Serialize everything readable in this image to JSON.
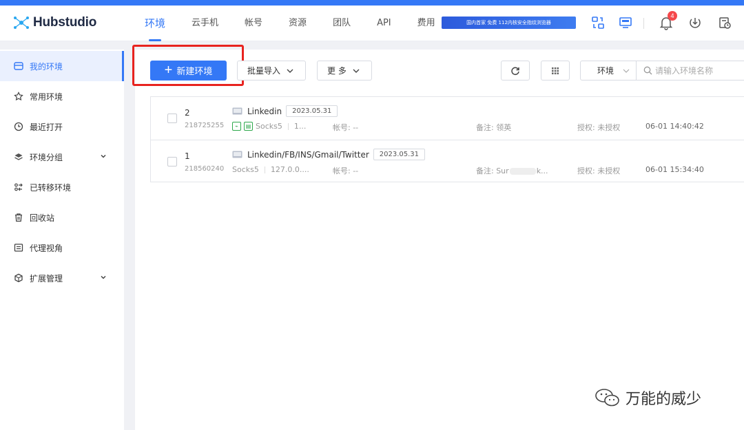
{
  "app": {
    "name": "Hubstudio"
  },
  "header": {
    "nav": [
      "环境",
      "云手机",
      "帐号",
      "资源",
      "团队",
      "API",
      "费用"
    ],
    "promo": "国内首家 免费 112内核安全指纹浏览器",
    "notification_count": "4",
    "icons": [
      "switch-env-icon",
      "monitor-icon",
      "bell-icon",
      "download-icon",
      "schedule-icon"
    ]
  },
  "sidebar": {
    "items": [
      {
        "label": "我的环境",
        "icon": "browser-window-icon",
        "active": true
      },
      {
        "label": "常用环境",
        "icon": "star-icon"
      },
      {
        "label": "最近打开",
        "icon": "clock-icon"
      },
      {
        "label": "环境分组",
        "icon": "layers-icon",
        "expandable": true
      },
      {
        "label": "已转移环境",
        "icon": "transfer-icon"
      },
      {
        "label": "回收站",
        "icon": "trash-icon"
      },
      {
        "label": "代理视角",
        "icon": "proxy-icon"
      },
      {
        "label": "扩展管理",
        "icon": "extension-icon",
        "expandable": true
      }
    ]
  },
  "toolbar": {
    "new_env": "新建环境",
    "batch_import": "批量导入",
    "more": "更 多",
    "search_scope": "环境",
    "search_placeholder": "请输入环境名称"
  },
  "environments": [
    {
      "seq": "2",
      "id": "218725255",
      "name": "Linkedin",
      "date": "2023.05.31",
      "proxy_type": "Socks5",
      "proxy_host": "1...",
      "account": "帐号: --",
      "remark_prefix": "备注: ",
      "remark": "领英",
      "auth": "授权: 未授权",
      "time": "06-01 14:40:42"
    },
    {
      "seq": "1",
      "id": "218560240",
      "name": "Linkedin/FB/INS/Gmail/Twitter",
      "date": "2023.05.31",
      "proxy_type": "Socks5",
      "proxy_host": "127.0.0....",
      "account": "帐号: --",
      "remark_prefix": "备注: ",
      "remark_start": "Sur",
      "remark_end": "k...",
      "auth": "授权: 未授权",
      "time": "06-01 15:34:40"
    }
  ],
  "watermark": "万能的威少",
  "colors": {
    "accent": "#3478f6",
    "highlight": "#e8231f",
    "badge": "#f5484b"
  }
}
